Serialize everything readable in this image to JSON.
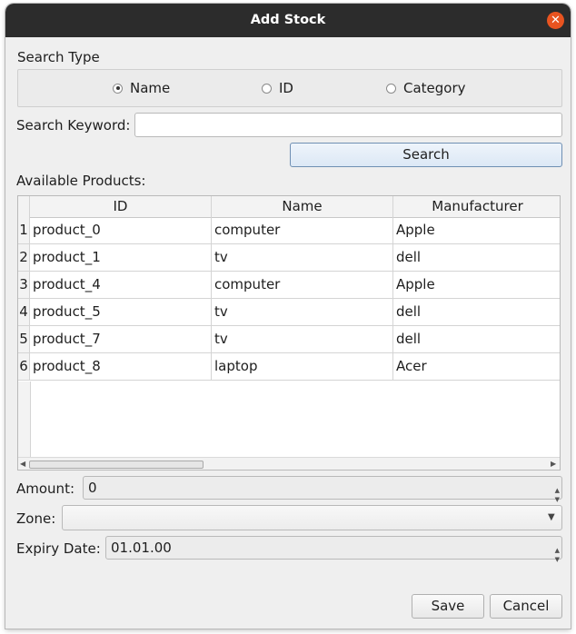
{
  "window": {
    "title": "Add Stock"
  },
  "search_type": {
    "label": "Search Type",
    "options": [
      {
        "label": "Name",
        "selected": true
      },
      {
        "label": "ID",
        "selected": false
      },
      {
        "label": "Category",
        "selected": false
      }
    ]
  },
  "search": {
    "keyword_label": "Search Keyword:",
    "keyword_value": "",
    "button_label": "Search"
  },
  "products": {
    "label": "Available Products:",
    "columns": [
      "ID",
      "Name",
      "Manufacturer"
    ],
    "rows": [
      {
        "num": "1",
        "id": "product_0",
        "name": "computer",
        "manufacturer": "Apple"
      },
      {
        "num": "2",
        "id": "product_1",
        "name": "tv",
        "manufacturer": "dell"
      },
      {
        "num": "3",
        "id": "product_4",
        "name": "computer",
        "manufacturer": "Apple"
      },
      {
        "num": "4",
        "id": "product_5",
        "name": "tv",
        "manufacturer": "dell"
      },
      {
        "num": "5",
        "id": "product_7",
        "name": "tv",
        "manufacturer": "dell"
      },
      {
        "num": "6",
        "id": "product_8",
        "name": "laptop",
        "manufacturer": "Acer"
      }
    ]
  },
  "amount": {
    "label": "Amount:",
    "value": "0"
  },
  "zone": {
    "label": "Zone:",
    "value": ""
  },
  "expiry": {
    "label": "Expiry Date:",
    "value": "01.01.00"
  },
  "buttons": {
    "save": "Save",
    "cancel": "Cancel"
  },
  "colors": {
    "titlebar": "#2c2c2c",
    "close": "#e95420",
    "accent": "#6f8fb3"
  }
}
